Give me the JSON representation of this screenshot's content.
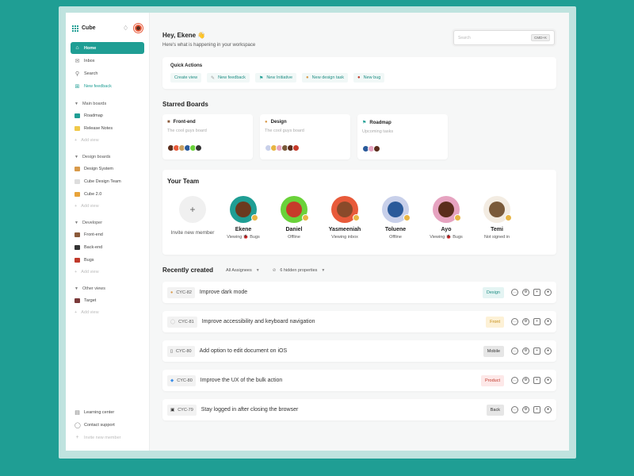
{
  "app": {
    "name": "Cube"
  },
  "sidebar": {
    "nav": [
      {
        "label": "Home",
        "icon": "home-icon"
      },
      {
        "label": "Inbox",
        "icon": "inbox-icon"
      },
      {
        "label": "Search",
        "icon": "search-icon"
      },
      {
        "label": "New feedback",
        "icon": "plus-icon"
      }
    ],
    "sections": [
      {
        "title": "Main boards",
        "items": [
          "Roadmap",
          "Release Notes"
        ],
        "add": "Add view"
      },
      {
        "title": "Design boards",
        "items": [
          "Design System",
          "Cube Design Team",
          "Cube 2.0"
        ],
        "add": "Add view"
      },
      {
        "title": "Developer",
        "items": [
          "Front-end",
          "Back-end",
          "Bugs"
        ],
        "add": "Add view"
      },
      {
        "title": "Other views",
        "items": [
          "Target"
        ],
        "add": "Add view"
      }
    ],
    "bottom": [
      "Learning center",
      "Contact support",
      "Invite new member"
    ]
  },
  "header": {
    "greeting": "Hey, Ekene 👋",
    "subtitle": "Here's what is happening in your workspace",
    "search_placeholder": "Search",
    "search_shortcut": "CMD+K"
  },
  "quick_actions": {
    "title": "Quick Actions",
    "items": [
      "Create view",
      "New feedback",
      "New Initiative",
      "New design task",
      "New bug"
    ]
  },
  "starred": {
    "title": "Starred Boards",
    "boards": [
      {
        "name": "Front-end",
        "desc": "The cool guys board"
      },
      {
        "name": "Design",
        "desc": "The cool guys board"
      },
      {
        "name": "Roadmap",
        "desc": "Upcoming tasks"
      }
    ]
  },
  "team": {
    "title": "Your Team",
    "invite_label": "Invite new member",
    "members": [
      {
        "name": "Ekene",
        "status": "Viewing 🐞 Bugs",
        "bg": "#1f9e94",
        "face": "#6b3a1f"
      },
      {
        "name": "Daniel",
        "status": "Offline",
        "bg": "#6ad23a",
        "face": "#c73a2a"
      },
      {
        "name": "Yasmeeniah",
        "status": "Viewing inbox",
        "bg": "#e85a3a",
        "face": "#8a4a2a"
      },
      {
        "name": "Toluene",
        "status": "Offline",
        "bg": "#c8d0ea",
        "face": "#2a5a9a"
      },
      {
        "name": "Ayo",
        "status": "Viewing 🐞 Bugs",
        "bg": "#e6a3c0",
        "face": "#5a2d1c"
      },
      {
        "name": "Temi",
        "status": "Not signed in",
        "bg": "#f3ece2",
        "face": "#7a5a3a"
      }
    ]
  },
  "recent": {
    "title": "Recently created",
    "filter_assignees": "All Assignees",
    "filter_hidden": "6 hidden properties",
    "tasks": [
      {
        "id": "CYC-82",
        "title": "Improve dark mode",
        "tag": "Design",
        "tag_bg": "#e4f4f3",
        "tag_color": "#1f8e84"
      },
      {
        "id": "CYC-81",
        "title": "Improve accessibility and keyboard navigation",
        "tag": "Front",
        "tag_bg": "#fdf1d6",
        "tag_color": "#c28a10"
      },
      {
        "id": "CYC-80",
        "title": "Add option to edit document on iOS",
        "tag": "Mobile",
        "tag_bg": "#e6e6e6",
        "tag_color": "#333333"
      },
      {
        "id": "CYC-80",
        "title": "Improve the UX of the bulk action",
        "tag": "Product",
        "tag_bg": "#fde8e8",
        "tag_color": "#c0392b"
      },
      {
        "id": "CYC-79",
        "title": "Stay logged in after closing the browser",
        "tag": "Back",
        "tag_bg": "#e6e6e6",
        "tag_color": "#333333"
      }
    ]
  }
}
